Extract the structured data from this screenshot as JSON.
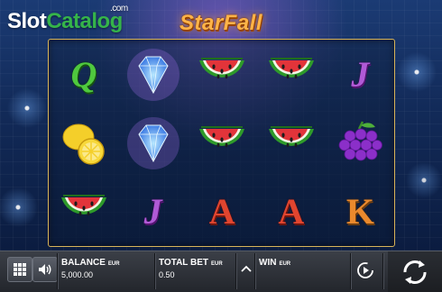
{
  "watermark": {
    "slot": "Slot",
    "catalog": "Catalog",
    "com": ".com"
  },
  "game": {
    "title": "StarFall"
  },
  "reels": [
    [
      "Q",
      "lemon",
      "watermelon"
    ],
    [
      "diamond",
      "diamond",
      "J"
    ],
    [
      "watermelon",
      "watermelon",
      "A"
    ],
    [
      "watermelon",
      "watermelon",
      "A"
    ],
    [
      "J",
      "grapes",
      "K"
    ]
  ],
  "bottom_bar": {
    "balance_label": "BALANCE",
    "balance_currency": "EUR",
    "balance_value": "5,000.00",
    "total_bet_label": "TOTAL BET",
    "total_bet_currency": "EUR",
    "total_bet_value": "0.50",
    "win_label": "WIN",
    "win_currency": "EUR",
    "menu_icon": "grid-menu-icon",
    "sound_icon": "speaker-icon",
    "bet_adjust_icon": "chevron-up-icon",
    "autoplay_icon": "autoplay-icon",
    "spin_icon": "spin-arrows-icon"
  },
  "colors": {
    "watermark_green": "#35b44a",
    "title_orange": "#ffb347",
    "reel_frame": "#d8b45a"
  }
}
